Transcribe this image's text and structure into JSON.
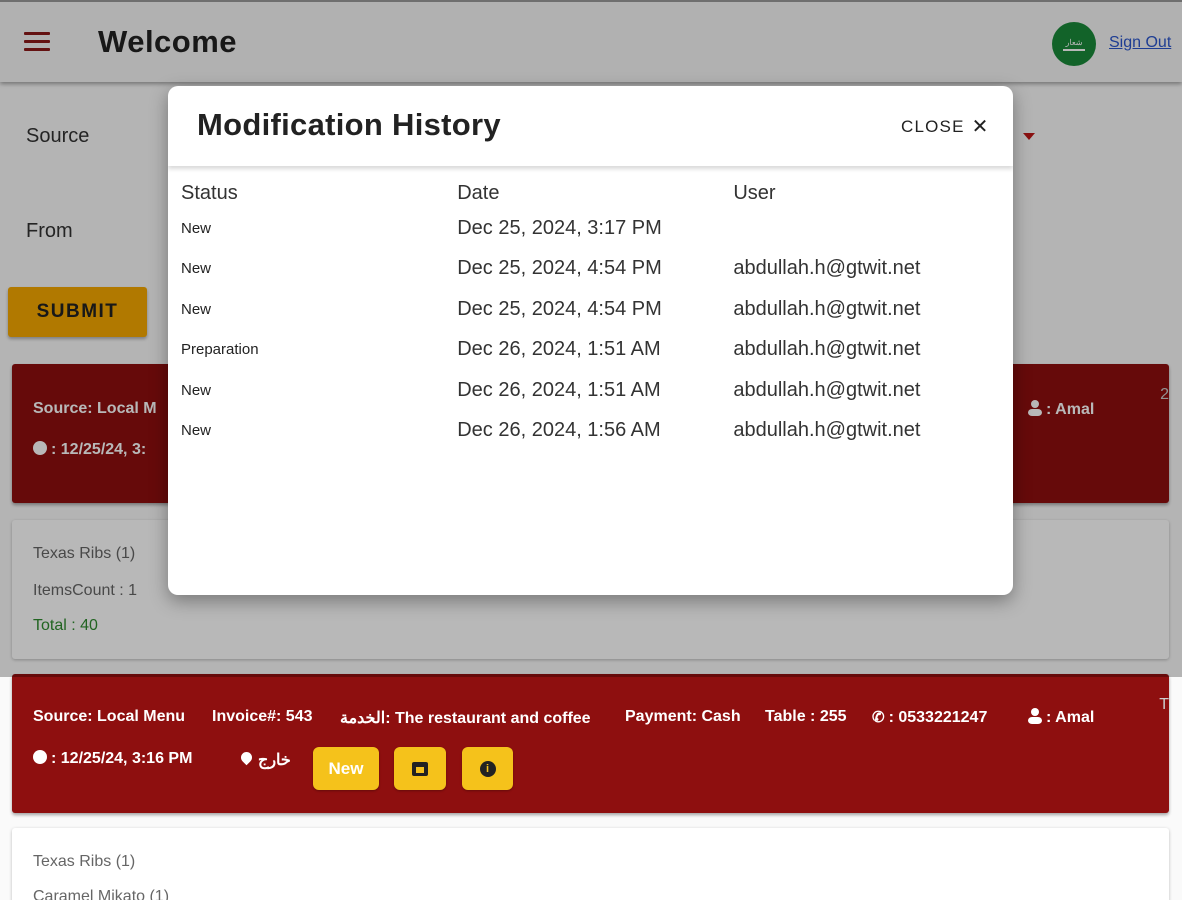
{
  "header": {
    "title": "Welcome",
    "flag_label": "شعار",
    "sign_out_label": "Sign Out"
  },
  "filters": {
    "source_label": "Source",
    "from_label": "From",
    "submit_label": "SUBMIT"
  },
  "orders": [
    {
      "source": "Source: Local M",
      "user": ": Amal",
      "time": ": 12/25/24, 3:",
      "items": [
        {
          "name": "Texas Ribs (1)"
        }
      ],
      "items_count": "ItemsCount : 1",
      "total": "Total : 40",
      "edge_mark": "2"
    },
    {
      "source": "Source: Local Menu",
      "invoice": "Invoice#: 543",
      "service": "الخدمة: The restaurant and coffee",
      "payment": "Payment: Cash",
      "table": "Table : 255",
      "phone": ": 0533221247",
      "user": ": Amal",
      "time": ": 12/25/24, 3:16 PM",
      "location": "خارج",
      "status_button": "New",
      "items": [
        {
          "name": "Texas Ribs (1)"
        },
        {
          "name": "Caramel Mikato (1)"
        }
      ],
      "edge_mark": "T"
    }
  ],
  "dialog": {
    "title": "Modification History",
    "close_label": "CLOSE",
    "columns": [
      "Status",
      "Date",
      "User"
    ],
    "rows": [
      {
        "status": "New",
        "date": "Dec 25, 2024, 3:17 PM",
        "user": ""
      },
      {
        "status": "New",
        "date": "Dec 25, 2024, 4:54 PM",
        "user": "abdullah.h@gtwit.net"
      },
      {
        "status": "New",
        "date": "Dec 25, 2024, 4:54 PM",
        "user": "abdullah.h@gtwit.net"
      },
      {
        "status": "Preparation",
        "date": "Dec 26, 2024, 1:51 AM",
        "user": "abdullah.h@gtwit.net"
      },
      {
        "status": "New",
        "date": "Dec 26, 2024, 1:51 AM",
        "user": "abdullah.h@gtwit.net"
      },
      {
        "status": "New",
        "date": "Dec 26, 2024, 1:56 AM",
        "user": "abdullah.h@gtwit.net"
      }
    ]
  },
  "colors": {
    "accent": "#8e0f0f",
    "submit": "#f5a800",
    "card_button": "#f5c21b",
    "total_green": "#2e8b2e"
  }
}
